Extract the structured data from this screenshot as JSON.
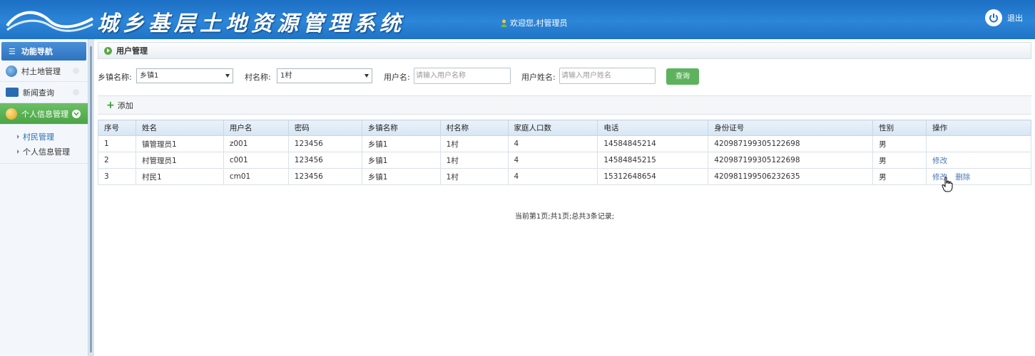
{
  "header": {
    "title": "城乡基层土地资源管理系统",
    "welcome": "欢迎您,村管理员",
    "logout_label": "退出",
    "accent_color": "#1f73c6"
  },
  "sidebar": {
    "nav_title": "功能导航",
    "items": [
      {
        "label": "村土地管理",
        "icon": "globe-icon"
      },
      {
        "label": "新闻查询",
        "icon": "news-icon"
      },
      {
        "label": "个人信息管理",
        "icon": "people-icon",
        "active": true
      }
    ],
    "sub_items": [
      {
        "label": "村民管理",
        "selected": true
      },
      {
        "label": "个人信息管理"
      }
    ]
  },
  "panel": {
    "title": "用户管理"
  },
  "search": {
    "town_label": "乡镇名称:",
    "town_value": "乡镇1",
    "village_label": "村名称:",
    "village_value": "1村",
    "username_label": "用户名:",
    "username_placeholder": "请输入用户名称",
    "realname_label": "用户姓名:",
    "realname_placeholder": "请输入用户姓名",
    "query_label": "查询"
  },
  "toolbar": {
    "add_label": "添加"
  },
  "table": {
    "headers": [
      "序号",
      "姓名",
      "用户名",
      "密码",
      "乡镇名称",
      "村名称",
      "家庭人口数",
      "电话",
      "身份证号",
      "性别",
      "操作"
    ],
    "rows": [
      [
        "1",
        "镇管理员1",
        "z001",
        "123456",
        "乡镇1",
        "1村",
        "4",
        "14584845214",
        "420987199305122698",
        "男"
      ],
      [
        "2",
        "村管理员1",
        "c001",
        "123456",
        "乡镇1",
        "1村",
        "4",
        "14584845215",
        "420987199305122698",
        "男"
      ],
      [
        "3",
        "村民1",
        "cm01",
        "123456",
        "乡镇1",
        "1村",
        "4",
        "15312648654",
        "420981199506232635",
        "男"
      ]
    ],
    "edit_label": "修改",
    "delete_label": "删除"
  },
  "pager": {
    "text": "当前第1页;共1页;总共3条记录;"
  }
}
